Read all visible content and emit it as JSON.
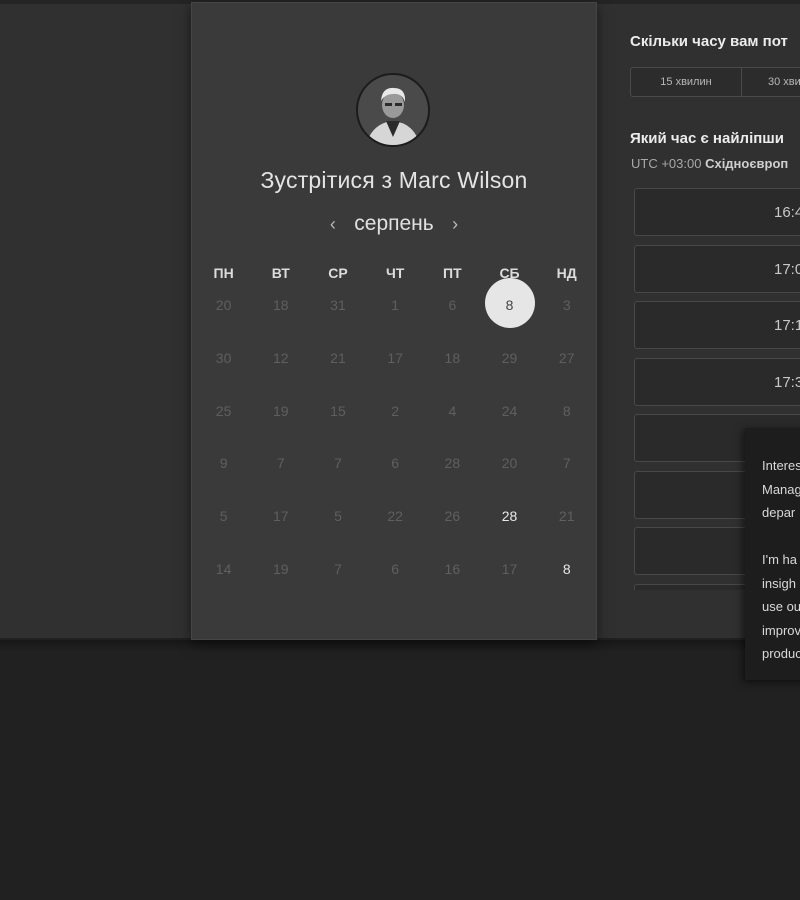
{
  "profile": {
    "meet_title": "Зустрітися з Marc Wilson"
  },
  "calendar": {
    "month": "серпень",
    "prev_icon": "‹",
    "next_icon": "›",
    "weekdays": [
      "ПН",
      "ВТ",
      "СР",
      "ЧТ",
      "ПТ",
      "СБ",
      "НД"
    ],
    "weeks": [
      [
        "20",
        "18",
        "31",
        "1",
        "6",
        "8",
        "3"
      ],
      [
        "30",
        "12",
        "21",
        "17",
        "18",
        "29",
        "27"
      ],
      [
        "25",
        "19",
        "15",
        "2",
        "4",
        "24",
        "8"
      ],
      [
        "9",
        "7",
        "7",
        "6",
        "28",
        "20",
        "7"
      ],
      [
        "5",
        "17",
        "5",
        "22",
        "26",
        "28",
        "21"
      ],
      [
        "14",
        "19",
        "7",
        "6",
        "16",
        "17",
        "8"
      ]
    ]
  },
  "right": {
    "duration_title": "Скільки часу вам пот",
    "durations": [
      "15 хвилин",
      "30 хви"
    ],
    "time_title": "Який час є найліпши",
    "tz_prefix": "UTC +03:00 ",
    "tz_name": "Східноєвроп",
    "slots": [
      "16:4",
      "17:0",
      "17:1",
      "17:3",
      "",
      "",
      "",
      ""
    ]
  },
  "popup": {
    "lines": [
      "Interes",
      "Manag",
      "depar",
      "",
      "I'm ha",
      "insigh",
      "use ou",
      "improv",
      "produc"
    ]
  },
  "colors": {
    "page_bg": "#212121",
    "card_bg": "#3a3a3a",
    "selected_day": "#e6e6e6"
  }
}
